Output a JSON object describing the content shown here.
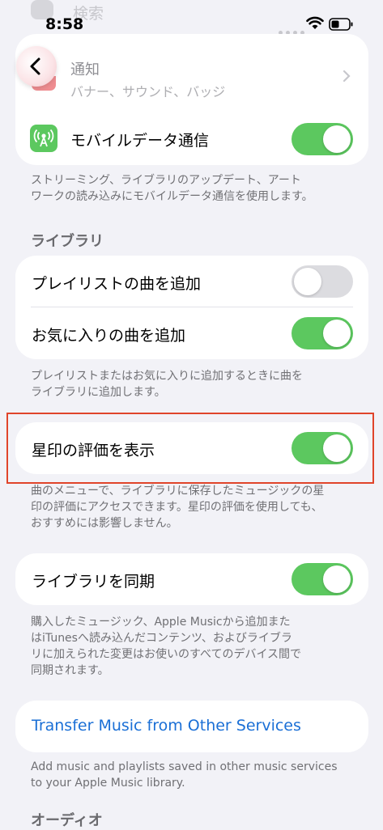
{
  "status_bar": {
    "time": "8:58",
    "search_ghost": "検索"
  },
  "notifications": {
    "title": "通知",
    "subtitle": "バナー、サウンド、バッジ"
  },
  "cellular": {
    "label": "モバイルデータ通信",
    "on": true,
    "footnote": [
      "ストリーミング、ライブラリのアップデート、アート",
      "ワークの読み込みにモバイルデータ通信を使用します。"
    ]
  },
  "library": {
    "header": "ライブラリ",
    "items": [
      {
        "label": "プレイリストの曲を追加",
        "on": false
      },
      {
        "label": "お気に入りの曲を追加",
        "on": true
      }
    ],
    "footnote": [
      "プレイリストまたはお気に入りに追加するときに曲を",
      "ライブラリに追加します。"
    ]
  },
  "star_ratings": {
    "label": "星印の評価を表示",
    "on": true,
    "footnote": [
      "曲のメニューで、ライブラリに保存したミュージックの星",
      "印の評価にアクセスできます。星印の評価を使用しても、",
      "おすすめには影響しません。"
    ]
  },
  "sync_library": {
    "label": "ライブラリを同期",
    "on": true,
    "footnote": [
      "購入したミュージック、Apple Musicから追加また",
      "はiTunesへ読み込んだコンテンツ、およびライブラ",
      "リに加えられた変更はお使いのすべてのデバイス間で",
      "同期されます。"
    ]
  },
  "transfer": {
    "label": "Transfer Music from Other Services",
    "footnote": [
      "Add music and playlists saved in other music services",
      "to your Apple Music library."
    ]
  },
  "audio_header": "オーディオ",
  "colors": {
    "toggle_on": "#5cc85f",
    "link": "#1a6fd6",
    "highlight": "#e0442a"
  },
  "icons": [
    "back-chevron-icon",
    "cellular-antenna-icon",
    "wifi-icon",
    "battery-icon",
    "chevron-right-icon"
  ]
}
